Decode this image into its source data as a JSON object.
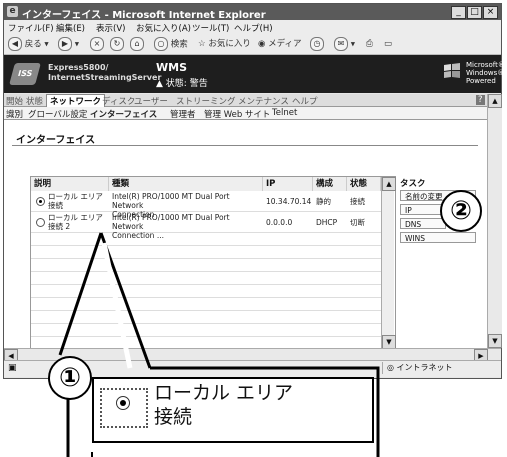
{
  "window": {
    "title": "インターフェイス - Microsoft Internet Explorer",
    "min": "_",
    "max": "□",
    "close": "×"
  },
  "menu": [
    "ファイル(F)",
    "編集(E)",
    "表示(V)",
    "お気に入り(A)",
    "ツール(T)",
    "ヘルプ(H)"
  ],
  "toolbar": {
    "back": "戻る",
    "search": "検索",
    "favorites": "お気に入り",
    "media": "メディア"
  },
  "banner": {
    "product_line1": "Express5800/",
    "product_line2": "InternetStreamingServer",
    "app": "WMS",
    "status": "状態: 警告",
    "ms_line1": "Microsoft®",
    "ms_line2": "Windows®",
    "ms_line3": "Powered"
  },
  "tabs": [
    "開始",
    "状態",
    "ネットワーク",
    "ディスク",
    "ユーザー",
    "ストリーミング",
    "メンテナンス",
    "ヘルプ"
  ],
  "help_mark": "?",
  "subtabs": [
    "識別",
    "グローバル設定",
    "インターフェイス",
    "管理者",
    "管理 Web サイト",
    "Telnet"
  ],
  "section_title": "インターフェイス",
  "columns": {
    "desc": "説明",
    "type": "種類",
    "ip": "IP",
    "config": "構成",
    "state": "状態"
  },
  "rows": [
    {
      "desc1": "ローカル エリア",
      "desc2": "接続",
      "type1": "Intel(R) PRO/1000 MT Dual Port Network",
      "type2": "Connection",
      "ip": "10.34.70.14",
      "config": "静的",
      "state": "接続",
      "selected": true
    },
    {
      "desc1": "ローカル エリア",
      "desc2": "接続 2",
      "type1": "Intel(R) PRO/1000 MT Dual Port Network",
      "type2": "Connection ...",
      "ip": "0.0.0.0",
      "config": "DHCP",
      "state": "切断",
      "selected": false
    }
  ],
  "tasks": {
    "title": "タスク",
    "items": [
      "名前の変更",
      "IP",
      "DNS",
      "WINS"
    ]
  },
  "statusbar": {
    "zone": "イントラネット"
  },
  "callouts": {
    "one": "①",
    "two": "②"
  },
  "zoom": {
    "line1": "ローカル エリア",
    "line2": "接続"
  }
}
